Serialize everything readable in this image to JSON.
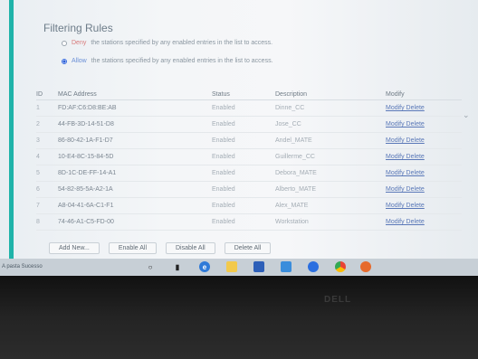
{
  "header": {
    "title": "Filtering Rules"
  },
  "filter_options": [
    {
      "prefix": "Deny",
      "text": "the stations specified by any enabled entries in the list to access.",
      "selected": false
    },
    {
      "prefix": "Allow",
      "text": "the stations specified by any enabled entries in the list to access.",
      "selected": true
    }
  ],
  "table": {
    "headers": [
      "ID",
      "MAC Address",
      "Status",
      "Description",
      "Modify"
    ],
    "rows": [
      {
        "id": "1",
        "mac": "FD:AF:C6:D8:BE:AB",
        "status": "Enabled",
        "desc": "Dinne_CC",
        "modify": "Modify Delete"
      },
      {
        "id": "2",
        "mac": "44-FB-3D-14-51-D8",
        "status": "Enabled",
        "desc": "Jose_CC",
        "modify": "Modify Delete"
      },
      {
        "id": "3",
        "mac": "86-80-42-1A-F1-D7",
        "status": "Enabled",
        "desc": "Andel_MATE",
        "modify": "Modify Delete"
      },
      {
        "id": "4",
        "mac": "10-E4-8C-15-84-5D",
        "status": "Enabled",
        "desc": "Guillerme_CC",
        "modify": "Modify Delete"
      },
      {
        "id": "5",
        "mac": "8D-1C-DE-FF-14-A1",
        "status": "Enabled",
        "desc": "Debora_MATE",
        "modify": "Modify Delete"
      },
      {
        "id": "6",
        "mac": "54-82-85-5A-A2-1A",
        "status": "Enabled",
        "desc": "Alberto_MATE",
        "modify": "Modify Delete"
      },
      {
        "id": "7",
        "mac": "A8-04-41-6A-C1-F1",
        "status": "Enabled",
        "desc": "Alex_MATE",
        "modify": "Modify Delete"
      },
      {
        "id": "8",
        "mac": "74-46-A1-C5-FD-00",
        "status": "Enabled",
        "desc": "Workstation",
        "modify": "Modify Delete"
      }
    ]
  },
  "buttons": {
    "add_new": "Add New...",
    "enable_all": "Enable All",
    "disable_all": "Disable All",
    "delete_all": "Delete All"
  },
  "taskbar": {
    "status": "A pasta Sucesso"
  },
  "bezel": {
    "logo": "DELL"
  },
  "colors": {
    "accent_rail": "#1fb3a9",
    "link": "#5a78b8"
  }
}
